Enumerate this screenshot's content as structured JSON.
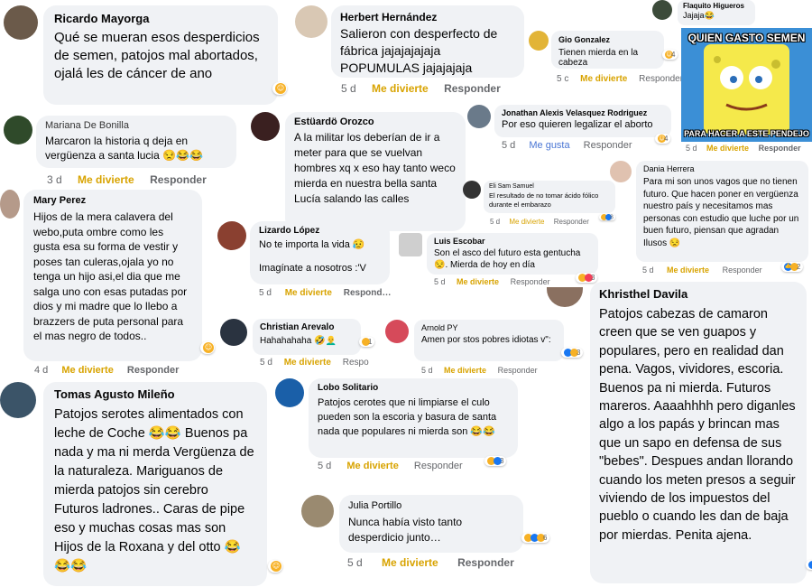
{
  "comments": [
    {
      "id": "ricardo",
      "name": "Ricardo Mayorga",
      "text": "Qué se mueran esos desperdicios de semen, patojos mal abortados, ojalá les de cáncer de ano"
    },
    {
      "id": "herbert",
      "name": "Herbert Hernández",
      "text": "Salieron con desperfecto de fábrica jajajajajaja POPUMULAS jajajajaja",
      "time": "5 d",
      "like": "Me divierte",
      "reply": "Responder"
    },
    {
      "id": "flaquito",
      "name": "Flaquito Higueros",
      "text": "Jajaja😂"
    },
    {
      "id": "gio",
      "name": "Gio Gonzalez",
      "text": "Tienen mierda en la cabeza",
      "time": "5 c",
      "like": "Me divierte",
      "reply": "Responder"
    },
    {
      "id": "mariana",
      "name": "Mariana De Bonilla",
      "text": "Marcaron la historia q deja en vergüenza a santa lucia 😒😂😂",
      "time": "3 d",
      "like": "Me divierte",
      "reply": "Responder"
    },
    {
      "id": "estuardo",
      "name": "Estüardö Orozco",
      "text": "A la militar los deberían de ir a meter para que se vuelvan hombres xq x eso hay tanto weco mierda en nuestra bella santa Lucía salando las calles"
    },
    {
      "id": "jonathan",
      "name": "Jonathan Alexis Velasquez Rodriguez",
      "text": "Por eso quieren legalizar el aborto",
      "time": "5 d",
      "like": "Me gusta",
      "reply": "Responder",
      "reactions": "4"
    },
    {
      "id": "dania",
      "name": "Dania Herrera",
      "text": "Para mi son unos vagos que no tienen futuro. Que hacen poner en vergüenza nuestro país y necesitamos mas personas con estudio que luche por un buen futuro, piensan que agradan Ilusos 😒",
      "time": "5 d",
      "like": "Me divierte",
      "reply": "Responder",
      "reactions": "2"
    },
    {
      "id": "elisam",
      "name": "Eli Sam Samuel",
      "text": "El resultado de no tomar ácido fólico durante el embarazo",
      "time": "5 d",
      "like": "Me divierte",
      "reply": "Responder",
      "reactions": "8"
    },
    {
      "id": "mary",
      "name": "Mary Perez",
      "text": "Hijos de la mera calavera del webo,puta ombre como les gusta esa su forma de vestir y poses tan culeras,ojala yo no tenga un hijo asi,el dia que me salga uno con esas putadas por dios y mi madre que lo llebo a brazzers de puta personal para el mas negro de todos..",
      "time": "4 d",
      "like": "Me divierte",
      "reply": "Responder"
    },
    {
      "id": "lizardo",
      "name": "Lizardo López",
      "text": "No te importa la vida 😥\n\nImagínate a nosotros :'V",
      "time": "5 d",
      "like": "Me divierte",
      "reply": "Respond…"
    },
    {
      "id": "luis",
      "name": "Luis Escobar",
      "text": "Son el asco del futuro esta gentucha 😒. Mierda de hoy en día",
      "time": "5 d",
      "like": "Me divierte",
      "reply": "Responder",
      "reactions": "3"
    },
    {
      "id": "christian",
      "name": "Christian Arevalo",
      "text": "Hahahahaha 🤣👨‍🦲",
      "time": "5 d",
      "like": "Me divierte",
      "reply": "Respo",
      "reactions": "1"
    },
    {
      "id": "arnold",
      "name": "Arnold PY",
      "text": "Amen por stos pobres idiotas v\":",
      "time": "5 d",
      "like": "Me divierte",
      "reply": "Responder",
      "reactions": "3"
    },
    {
      "id": "khristhel",
      "name": "Khristhel Davila",
      "text": "Patojos cabezas de camaron creen que se ven guapos y populares, pero en realidad dan pena. Vagos, vividores, escoria. Buenos pa ni mierda. Futuros mareros. Aaaahhhh pero diganles algo a los papás y brincan mas que un sapo en defensa de sus \"bebes\". Despues andan llorando cuando los meten presos a seguir viviendo de los impuestos del pueblo o cuando les dan de baja por mierdas. Penita ajena."
    },
    {
      "id": "tomas",
      "name": "Tomas Agusto Mileño",
      "text": "Patojos serotes alimentados con leche de Coche 😂😂 Buenos pa nada y ma ni merda Vergüenza de la naturaleza. Mariguanos de mierda patojos sin cerebro Futuros ladrones.. Caras de pipe eso y muchas cosas mas son Hijos de la Roxana y del otto 😂😂😂"
    },
    {
      "id": "lobo",
      "name": "Lobo Solitario",
      "text": "Patojos cerotes que ni limpiarse el culo pueden son la escoria y basura de santa nada que populares ni mierda son 😂😂",
      "time": "5 d",
      "like": "Me divierte",
      "reply": "Responder",
      "reactions": "3"
    },
    {
      "id": "julia",
      "name": "Julia Portillo",
      "text": "Nunca había visto tanto desperdicio junto…",
      "time": "5 d",
      "like": "Me divierte",
      "reply": "Responder",
      "reactions": "6"
    }
  ],
  "meme": {
    "top": "QUIEN GASTO SEMEN",
    "bottom": "PARA HACER A ESTE PENDEJO",
    "time": "5 d",
    "like": "Me divierte",
    "reply": "Responder"
  },
  "colors": {
    "bubble": "#f0f2f5",
    "like_orange": "#d8a300",
    "like_blue": "#4a76d4",
    "meta_gray": "#65676b",
    "meme_bg": "#f6e64c"
  }
}
